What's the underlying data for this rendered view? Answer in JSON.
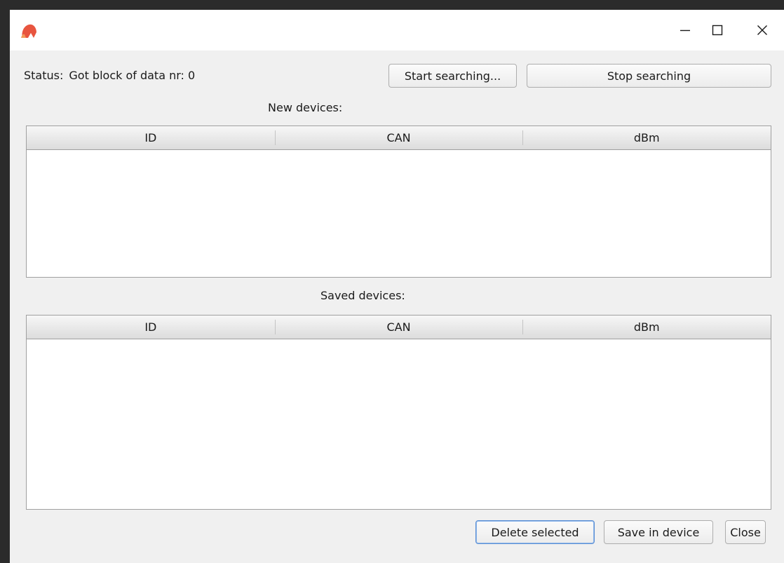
{
  "titlebar": {
    "app_icon": "app-logo-icon",
    "minimize_icon": "minimize-icon",
    "maximize_icon": "maximize-icon",
    "close_icon": "close-icon"
  },
  "status": {
    "label": "Status:",
    "value": "Got block of data nr: 0"
  },
  "buttons": {
    "start": "Start searching...",
    "stop": "Stop searching",
    "delete": "Delete selected",
    "save": "Save in device",
    "close": "Close"
  },
  "new_devices": {
    "title": "New devices:",
    "columns": [
      "ID",
      "CAN",
      "dBm"
    ],
    "rows": []
  },
  "saved_devices": {
    "title": "Saved devices:",
    "columns": [
      "ID",
      "CAN",
      "dBm"
    ],
    "rows": []
  },
  "colors": {
    "window_bg": "#f0f0f0",
    "titlebar_bg": "#ffffff",
    "default_button_border": "#5b8fd4",
    "app_icon_primary": "#e8553f",
    "app_icon_secondary": "#f29a5a"
  }
}
